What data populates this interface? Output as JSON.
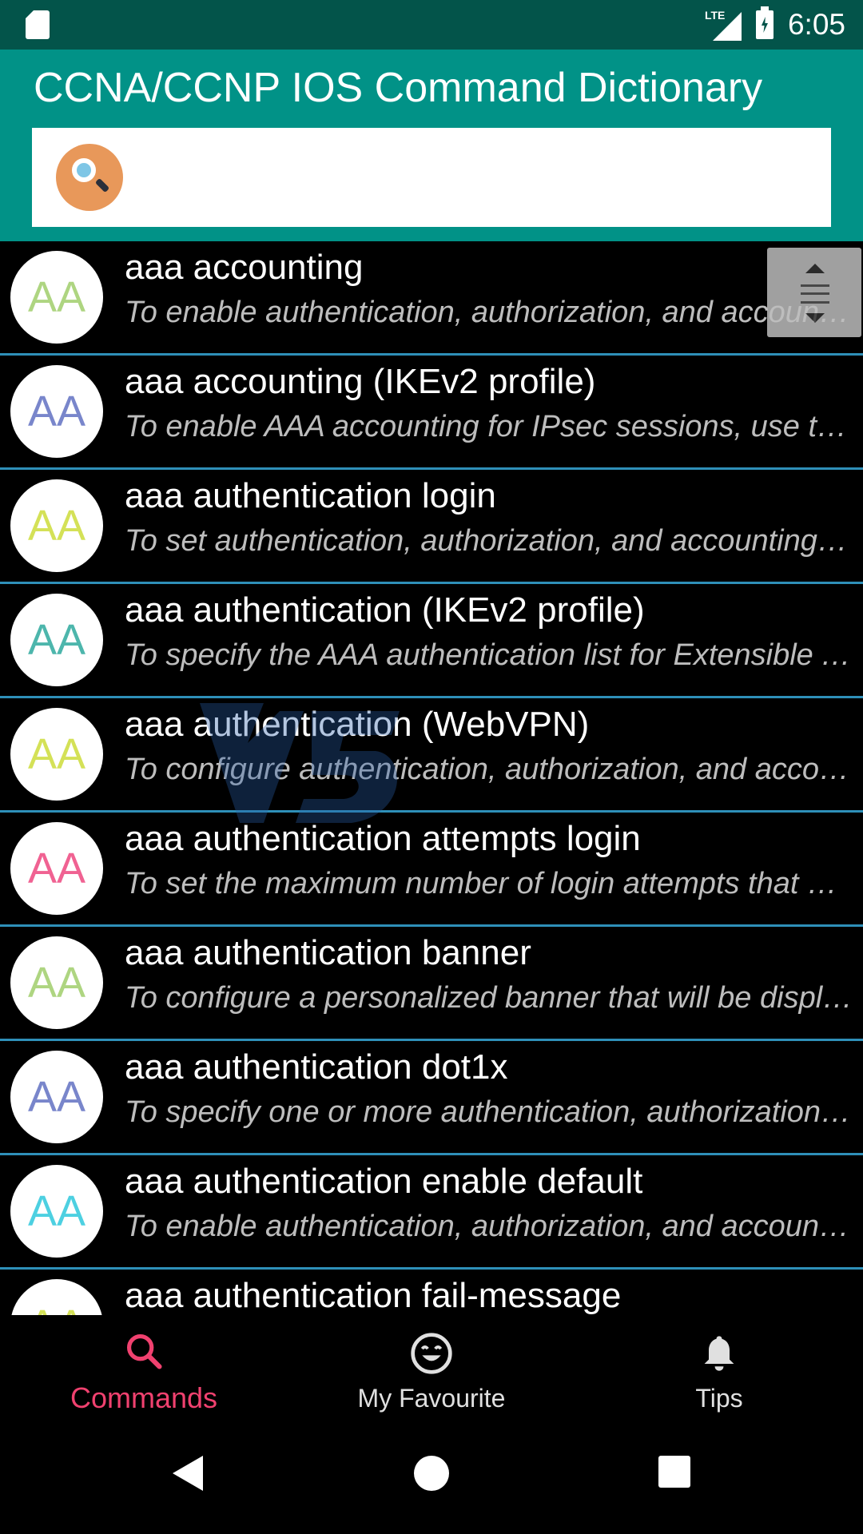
{
  "status_bar": {
    "network": "LTE",
    "time": "6:05"
  },
  "app": {
    "title": "CCNA/CCNP IOS Command Dictionary"
  },
  "search": {
    "value": "",
    "placeholder": ""
  },
  "colors": {
    "status_bar": "#03544a",
    "app_bar": "#019287",
    "divider": "#2e8fb8",
    "active_tab": "#f0416f"
  },
  "commands": [
    {
      "avatar": "AA",
      "avatar_color": "#aed581",
      "title": "aaa accounting",
      "desc": "To enable authentication, authorization, and accounting (AAA) accounting of requested services"
    },
    {
      "avatar": "AA",
      "avatar_color": "#7986cb",
      "title": "aaa accounting (IKEv2 profile)",
      "desc": "To enable AAA accounting for IPsec sessions, use the aaa accounting command"
    },
    {
      "avatar": "AA",
      "avatar_color": "#d4e157",
      "title": "aaa authentication login",
      "desc": "To set authentication, authorization, and accounting (AAA) authentication at login"
    },
    {
      "avatar": "AA",
      "avatar_color": "#4db6ac",
      "title": "aaa authentication (IKEv2 profile)",
      "desc": "To specify the AAA authentication list for Extensible Authentication Protocol"
    },
    {
      "avatar": "AA",
      "avatar_color": "#d4e157",
      "title": "aaa authentication (WebVPN)",
      "desc": "To configure authentication, authorization, and accounting (AAA) authentication"
    },
    {
      "avatar": "AA",
      "avatar_color": "#f06292",
      "title": "aaa authentication attempts login",
      "desc": "To set the maximum number of login attempts that will be permitted"
    },
    {
      "avatar": "AA",
      "avatar_color": "#aed581",
      "title": "aaa authentication banner",
      "desc": "To configure a personalized banner that will be displayed when a user logs in"
    },
    {
      "avatar": "AA",
      "avatar_color": "#7986cb",
      "title": "aaa authentication dot1x",
      "desc": "To specify one or more authentication, authorization, and accounting (AAA) methods"
    },
    {
      "avatar": "AA",
      "avatar_color": "#4dd0e1",
      "title": "aaa authentication enable default",
      "desc": "To enable authentication, authorization, and accounting (AAA) authentication"
    },
    {
      "avatar": "AA",
      "avatar_color": "#d4e157",
      "title": "aaa authentication fail-message",
      "desc": ""
    }
  ],
  "bottom_nav": {
    "commands_label": "Commands",
    "favourite_label": "My Favourite",
    "tips_label": "Tips"
  }
}
